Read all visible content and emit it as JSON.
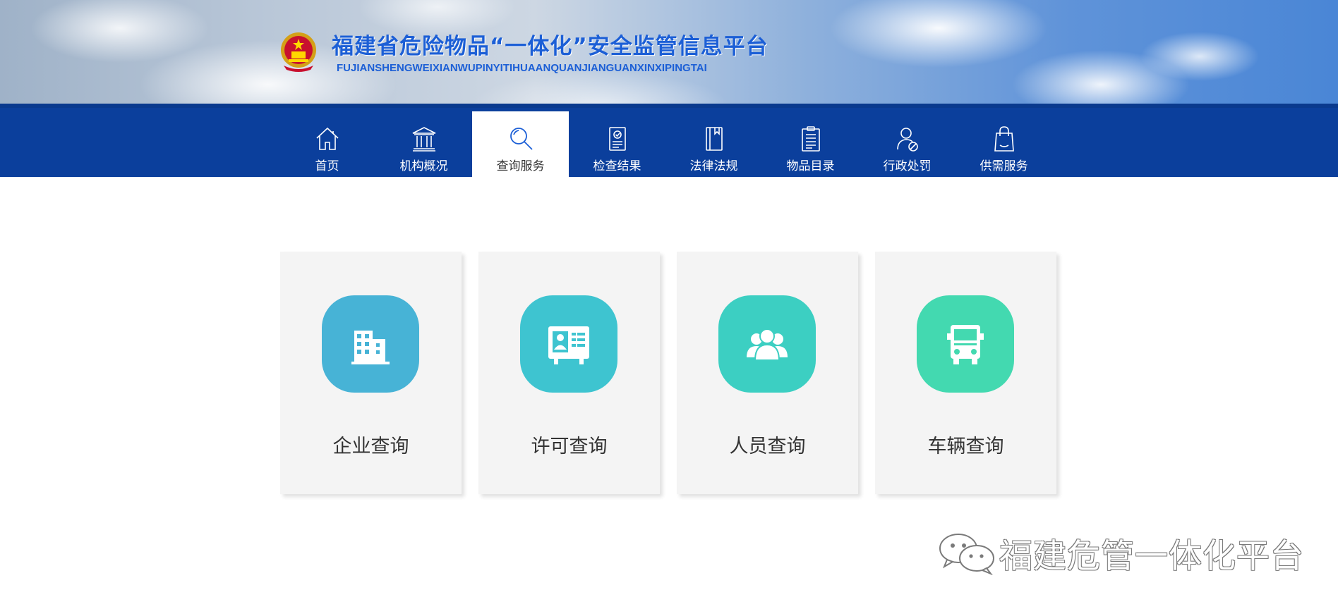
{
  "header": {
    "title": "福建省危险物品“一体化”安全监管信息平台",
    "subtitle": "FUJIANSHENGWEIXIANWUPINYITIHUAANQUANJIANGUANXINXIPINGTAI",
    "emblem_icon": "national-emblem-icon"
  },
  "nav": {
    "items": [
      {
        "label": "首页",
        "icon": "home-icon",
        "active": false
      },
      {
        "label": "机构概况",
        "icon": "institution-icon",
        "active": false
      },
      {
        "label": "查询服务",
        "icon": "search-icon",
        "active": true
      },
      {
        "label": "检查结果",
        "icon": "inspection-document-icon",
        "active": false
      },
      {
        "label": "法律法规",
        "icon": "law-book-icon",
        "active": false
      },
      {
        "label": "物品目录",
        "icon": "clipboard-list-icon",
        "active": false
      },
      {
        "label": "行政处罚",
        "icon": "user-penalty-icon",
        "active": false
      },
      {
        "label": "供需服务",
        "icon": "shopping-bag-icon",
        "active": false
      }
    ]
  },
  "cards": [
    {
      "label": "企业查询",
      "icon": "building-icon",
      "color": "#47b3d6"
    },
    {
      "label": "许可查询",
      "icon": "id-card-icon",
      "color": "#3ec4d0"
    },
    {
      "label": "人员查询",
      "icon": "people-group-icon",
      "color": "#3ccfc2"
    },
    {
      "label": "车辆查询",
      "icon": "truck-icon",
      "color": "#43d9b0"
    }
  ],
  "watermark": {
    "text": "福建危管一体化平台",
    "icon": "wechat-icon"
  },
  "colors": {
    "nav_bg": "#0b3f9c",
    "title_blue": "#1c5fd6",
    "card_bg": "#f4f4f4"
  }
}
